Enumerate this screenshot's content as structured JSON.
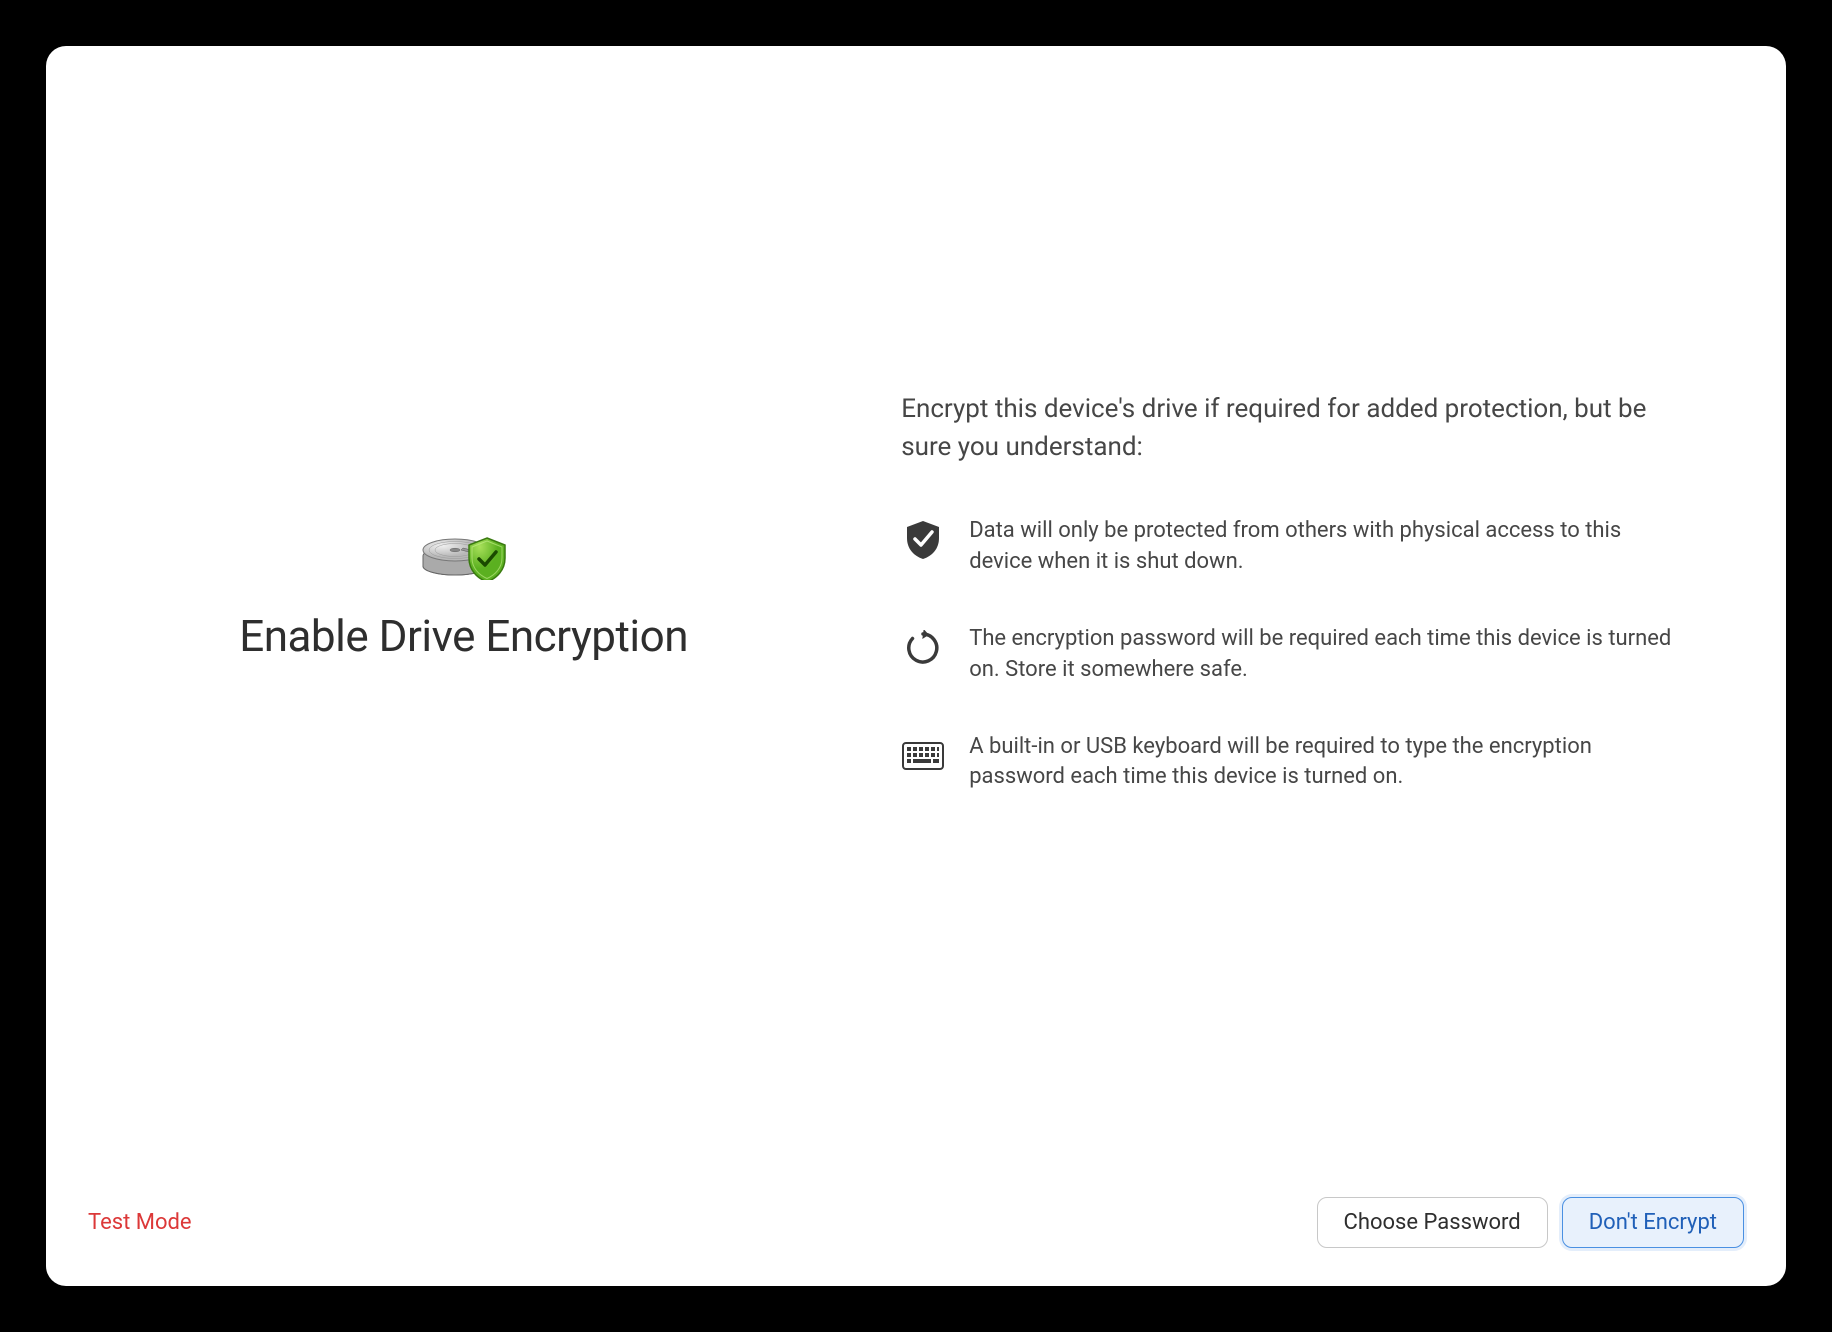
{
  "title": "Enable Drive Encryption",
  "intro": "Encrypt this device's drive if required for added protection, but be sure you understand:",
  "items": [
    {
      "text": "Data will only be protected from others with physical access to this device when it is shut down."
    },
    {
      "text": "The encryption password will be required each time this device is turned on. Store it somewhere safe."
    },
    {
      "text": "A built-in or USB keyboard will be required to type the encryption password each time this device is turned on."
    }
  ],
  "footer": {
    "test_mode": "Test Mode",
    "choose_password": "Choose Password",
    "dont_encrypt": "Don't Encrypt"
  }
}
